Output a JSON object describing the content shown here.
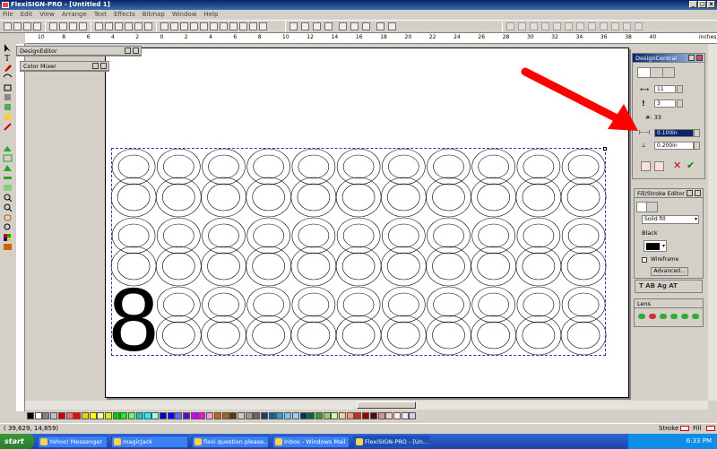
{
  "window": {
    "title": "FlexiSIGN-PRO - [Untitled 1]"
  },
  "menu": [
    "File",
    "Edit",
    "View",
    "Arrange",
    "Text",
    "Effects",
    "Bitmap",
    "Window",
    "Help"
  ],
  "ruler": {
    "ticks": [
      "10",
      "8",
      "6",
      "4",
      "2",
      "0",
      "2",
      "4",
      "6",
      "8",
      "10",
      "12",
      "14",
      "16",
      "18",
      "20",
      "22",
      "24",
      "26",
      "28",
      "30",
      "32",
      "34",
      "36",
      "38",
      "40"
    ],
    "unit": "inches"
  },
  "panels": {
    "design_editor": {
      "title": "DesignEditor"
    },
    "color_mixer": {
      "title": "Color Mixer"
    },
    "design_central": {
      "title": "DesignCentral",
      "count_x": "11",
      "count_y": "3",
      "total_label": "#: 33",
      "h_spacing": "0.100in",
      "v_spacing": "0.200in"
    },
    "fill_stroke": {
      "title": "Fill/Stroke Editor",
      "fill_type": "Solid fill",
      "color_name": "Black",
      "wireframe_label": "Wireframe",
      "advanced_label": "Advanced...",
      "text_toolbar": "T  AB  Ag  AT"
    },
    "lens": {
      "title": "Lens"
    }
  },
  "canvas": {
    "glyph": "8",
    "grid_cols": 11,
    "grid_rows": 3,
    "filled_index": 22
  },
  "statusbar": {
    "coords": "( 39,629,    14,859)",
    "stroke_label": "Stroke",
    "fill_label": "Fill"
  },
  "taskbar": {
    "start": "start",
    "tasks": [
      "Yahoo! Messenger",
      "magicJack",
      "flexi question please...",
      "Inbox - Windows Mail",
      "FlexiSIGN-PRO - [Un..."
    ],
    "clock": "6:33 PM"
  },
  "colors": {
    "arrow": "#ff0000",
    "selection": "#3333aa"
  }
}
